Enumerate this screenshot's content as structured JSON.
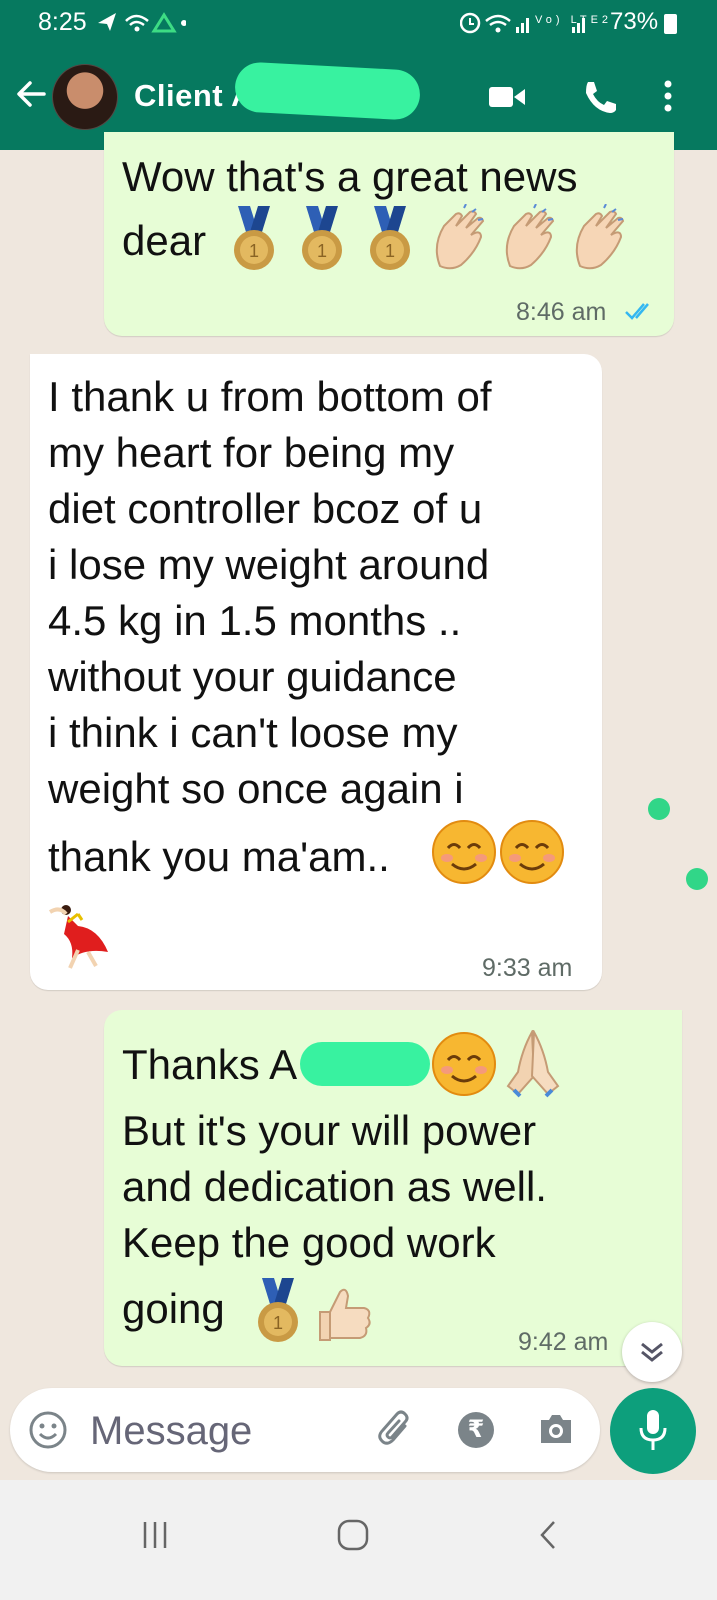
{
  "status_bar": {
    "time": "8:25",
    "battery": "73%",
    "lte_label": "Vo) LTE2"
  },
  "header": {
    "contact_name": "Client A",
    "back_icon": "arrow-left-icon",
    "icons": [
      "video-call-icon",
      "voice-call-icon",
      "more-vert-icon"
    ]
  },
  "messages": [
    {
      "direction": "outgoing",
      "lines": [
        "Wow that's a great news",
        "dear"
      ],
      "emoji": [
        "first-place-medal",
        "first-place-medal",
        "first-place-medal",
        "clapping-hands",
        "clapping-hands",
        "clapping-hands"
      ],
      "time": "8:46 am",
      "read": true
    },
    {
      "direction": "incoming",
      "lines": [
        "I thank u from bottom of",
        "my heart for being my",
        "diet controller bcoz of u",
        "i lose my weight around",
        "4.5 kg in 1.5 months ..",
        "without your guidance",
        "i think i can't loose my",
        "weight so once again i",
        "thank you ma'am.."
      ],
      "emoji": [
        "smiling-face",
        "smiling-face",
        "dancing-woman"
      ],
      "time": "9:33 am"
    },
    {
      "direction": "outgoing",
      "lines": [
        "Thanks A",
        "But it's your will power",
        "and dedication as well.",
        "Keep the good work",
        "going"
      ],
      "emoji": [
        "smiling-face",
        "folded-hands",
        "first-place-medal",
        "thumbs-up"
      ],
      "time": "9:42 am"
    }
  ],
  "composer": {
    "placeholder": "Message",
    "currency_symbol": "₹",
    "icons": [
      "emoji-icon",
      "attach-icon",
      "rupee-icon",
      "camera-icon",
      "mic-icon"
    ]
  },
  "colors": {
    "header": "#06795f",
    "chat_bg": "#efe7de",
    "outgoing_bubble": "#e7fdd6",
    "incoming_bubble": "#ffffff",
    "accent_green": "#0d9f7c",
    "read_tick": "#34b7f1"
  }
}
